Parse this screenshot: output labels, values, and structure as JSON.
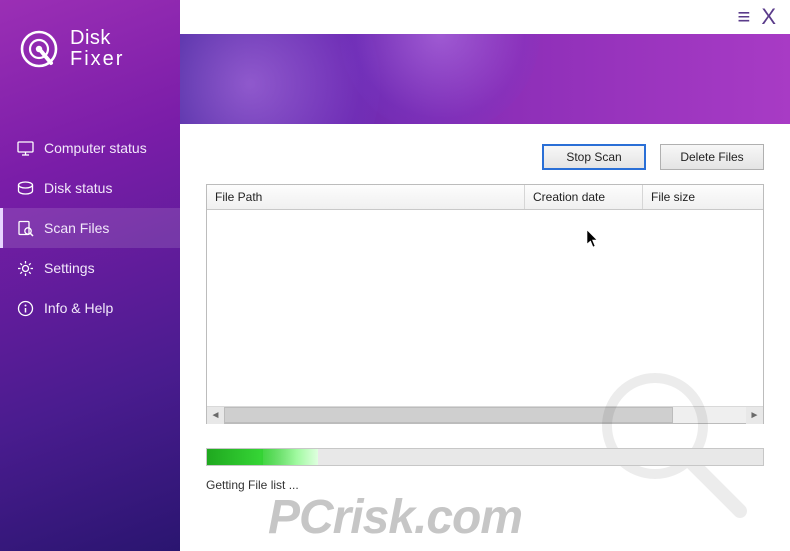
{
  "app": {
    "name_line1": "Disk",
    "name_line2": "Fixer"
  },
  "window_controls": {
    "menu_glyph": "≡",
    "close_glyph": "X"
  },
  "sidebar": {
    "items": [
      {
        "id": "computer-status",
        "label": "Computer status",
        "active": false
      },
      {
        "id": "disk-status",
        "label": "Disk status",
        "active": false
      },
      {
        "id": "scan-files",
        "label": "Scan Files",
        "active": true
      },
      {
        "id": "settings",
        "label": "Settings",
        "active": false
      },
      {
        "id": "info-help",
        "label": "Info & Help",
        "active": false
      }
    ]
  },
  "buttons": {
    "stop_scan": "Stop Scan",
    "delete_files": "Delete Files"
  },
  "table": {
    "columns": [
      "File Path",
      "Creation date",
      "File size"
    ],
    "rows": []
  },
  "progress": {
    "percent": 19,
    "status": "Getting File list ..."
  },
  "watermark": "PCrisk.com",
  "colors": {
    "accent": "#7a1da8",
    "button_focus": "#2a6fd6",
    "progress_green": "#1fa81f"
  }
}
